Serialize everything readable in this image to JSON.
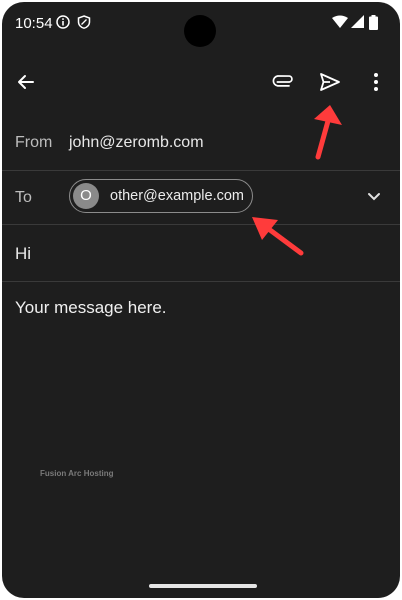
{
  "status_bar": {
    "time": "10:54",
    "icons": [
      "info-icon",
      "shield-icon",
      "wifi-icon",
      "signal-icon",
      "battery-icon"
    ]
  },
  "app_bar": {
    "back_icon": "arrow-left-icon",
    "attach_icon": "paperclip-icon",
    "send_icon": "send-icon",
    "more_icon": "more-vert-icon"
  },
  "compose": {
    "from_label": "From",
    "from_value": "john@zeromb.com",
    "to_label": "To",
    "recipient": {
      "initial": "O",
      "email": "other@example.com"
    },
    "subject": "Hi",
    "body": "Your message here."
  },
  "watermark": "Fusion Arc Hosting",
  "colors": {
    "background": "#1e1e1e",
    "divider": "#3a3a3a",
    "annotation_arrow": "#ff3b3b"
  }
}
